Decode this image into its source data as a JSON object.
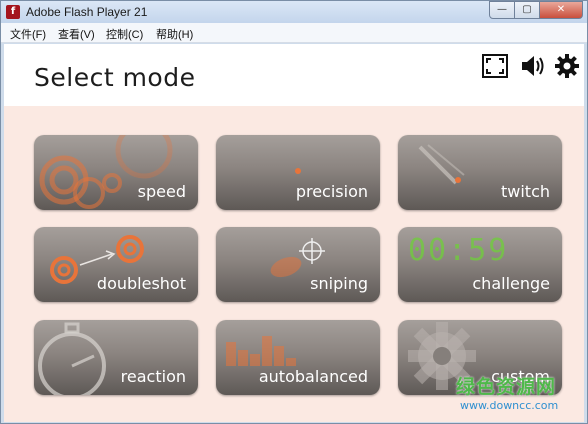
{
  "window": {
    "title": "Adobe Flash Player 21",
    "app_icon_glyph": "f",
    "buttons": {
      "minimize": "—",
      "maximize": "▢",
      "close": "✕"
    }
  },
  "menu": {
    "items": [
      "文件(F)",
      "查看(V)",
      "控制(C)",
      "帮助(H)"
    ]
  },
  "header": {
    "title": "Select mode",
    "icons": [
      "fullscreen-icon",
      "speaker-icon",
      "gear-icon"
    ]
  },
  "modes": [
    {
      "label": "speed"
    },
    {
      "label": "precision"
    },
    {
      "label": "twitch"
    },
    {
      "label": "doubleshot"
    },
    {
      "label": "sniping"
    },
    {
      "label": "challenge",
      "timer": "00:59"
    },
    {
      "label": "reaction"
    },
    {
      "label": "autobalanced"
    },
    {
      "label": "custom"
    }
  ],
  "watermark": {
    "text": "绿色资源网",
    "url": "www.downcc.com"
  },
  "colors": {
    "accent_orange": "#e8743a",
    "tile_bg": "#8b8480",
    "content_bg": "#fbe9e2",
    "timer_green": "#6fcf3a"
  }
}
